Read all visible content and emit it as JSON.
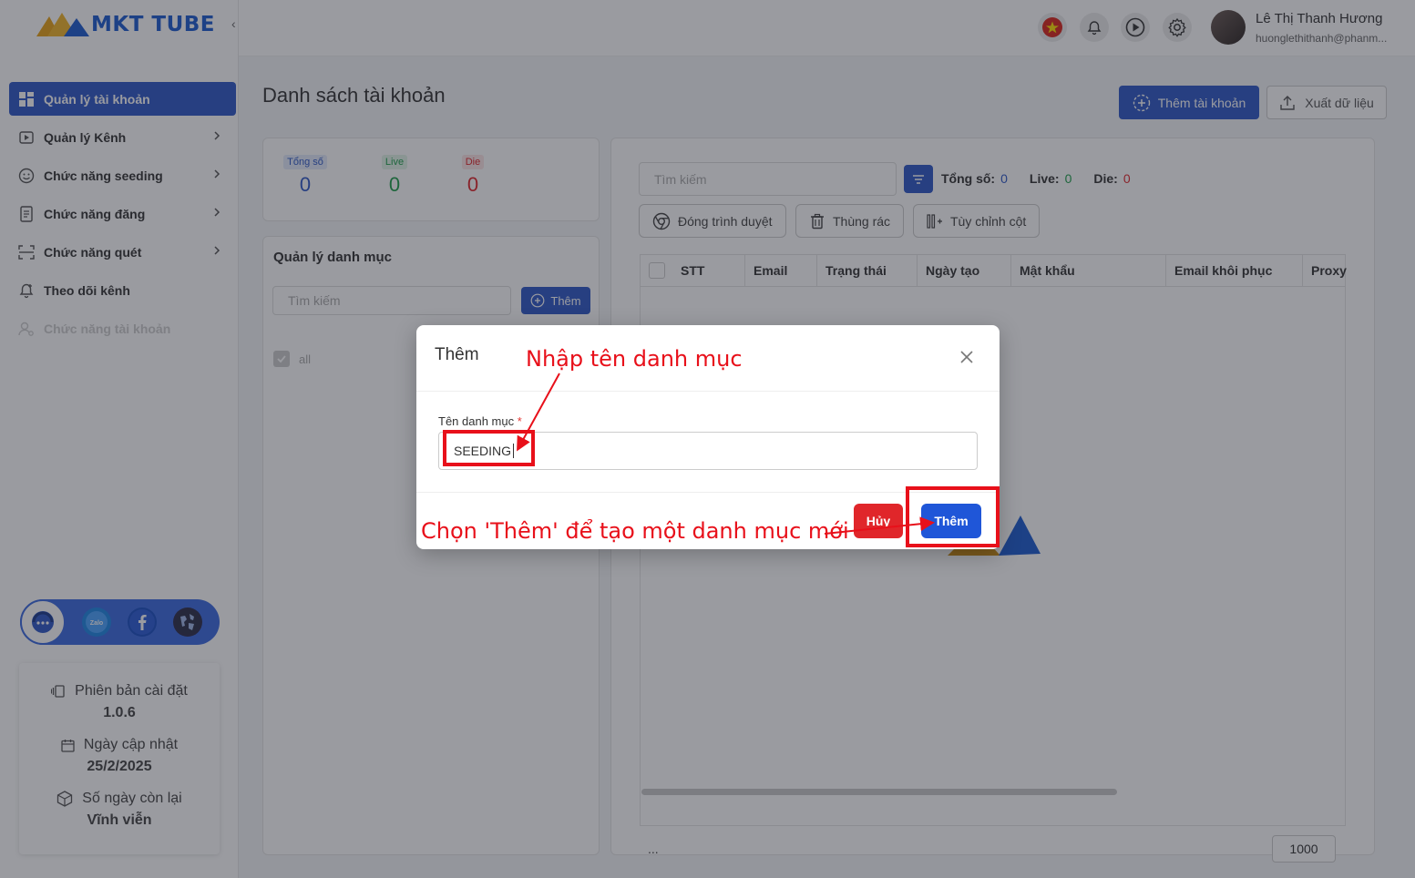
{
  "app": {
    "brand": "MKT TUBE",
    "collapse": "‹"
  },
  "sidebar": {
    "items": [
      {
        "label": "Quản lý tài khoản",
        "icon": "dashboard-icon",
        "active": true,
        "chevron": false
      },
      {
        "label": "Quản lý Kênh",
        "icon": "play-square-icon",
        "chevron": true
      },
      {
        "label": "Chức năng seeding",
        "icon": "smile-icon",
        "chevron": true
      },
      {
        "label": "Chức năng đăng",
        "icon": "document-icon",
        "chevron": true
      },
      {
        "label": "Chức năng quét",
        "icon": "scan-icon",
        "chevron": true
      },
      {
        "label": "Theo dõi kênh",
        "icon": "bell-plus-icon",
        "chevron": false
      },
      {
        "label": "Chức năng tài khoản",
        "icon": "user-settings-icon",
        "chevron": false,
        "disabled": true
      }
    ],
    "social": [
      "support-chat-icon",
      "zalo-icon",
      "facebook-icon",
      "globe-icon"
    ],
    "version": {
      "installed_label": "Phiên bản cài đặt",
      "installed_value": "1.0.6",
      "updated_label": "Ngày cập nhật",
      "updated_value": "25/2/2025",
      "remaining_label": "Số ngày còn lại",
      "remaining_value": "Vĩnh viễn"
    }
  },
  "header": {
    "user_name": "Lê Thị Thanh Hương",
    "user_email": "huonglethithanh@phanm..."
  },
  "page": {
    "title": "Danh sách tài khoản",
    "add_account": "Thêm tài khoản",
    "export": "Xuất dữ liệu"
  },
  "stats": {
    "total_label": "Tổng số",
    "total_value": "0",
    "live_label": "Live",
    "live_value": "0",
    "die_label": "Die",
    "die_value": "0"
  },
  "category": {
    "title": "Quản lý danh mục",
    "search_placeholder": "Tìm kiếm",
    "add_label": "Thêm",
    "items": [
      "all"
    ]
  },
  "accounts": {
    "search_placeholder": "Tìm kiếm",
    "total_label": "Tổng số:",
    "total_value": "0",
    "live_label": "Live:",
    "live_value": "0",
    "die_label": "Die:",
    "die_value": "0",
    "tools": [
      "Đóng trình duyệt",
      "Thùng rác",
      "Tùy chỉnh cột"
    ],
    "columns": [
      "STT",
      "Email",
      "Trạng thái",
      "Ngày tạo",
      "Mật khẩu",
      "Email khôi phục",
      "Proxy"
    ],
    "footer_dots": "...",
    "page_size": "1000"
  },
  "modal": {
    "title": "Thêm",
    "field_label": "Tên danh mục",
    "required_mark": "*",
    "field_value": "SEEDING",
    "cancel": "Hủy",
    "submit": "Thêm"
  },
  "annotations": {
    "input_hint": "Nhập tên danh mục",
    "button_hint": "Chọn 'Thêm' để tạo một danh mục mới"
  },
  "colors": {
    "primary": "#2e58c6",
    "danger": "#e0262a",
    "annotation": "#e8101a",
    "live": "#1e9e4a"
  }
}
